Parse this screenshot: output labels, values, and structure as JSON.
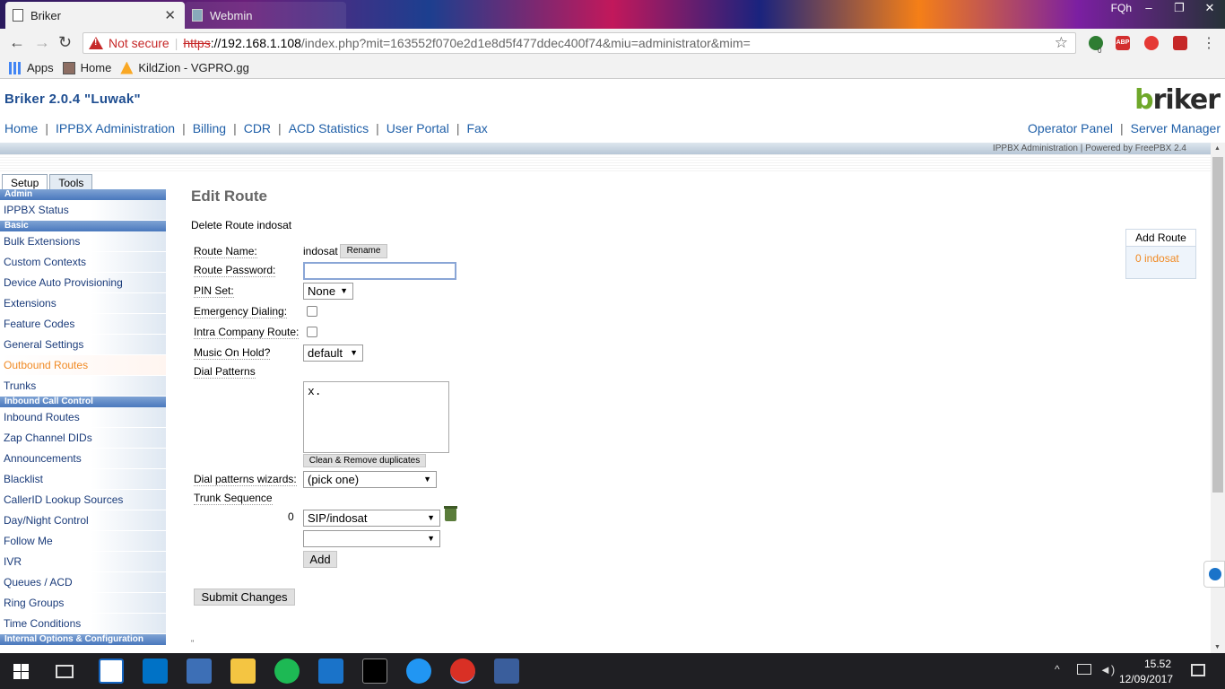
{
  "browser": {
    "tabs": [
      {
        "label": "Briker",
        "active": true
      },
      {
        "label": "Webmin",
        "active": false
      }
    ],
    "window_user": "FQh",
    "window_controls": [
      "–",
      "❐",
      "✕"
    ],
    "security_label": "Not secure",
    "url_scheme": "https",
    "url_host": "://192.168.1.108",
    "url_path": "/index.php?mit=163552f070e2d1e8d5f477ddec400f74&miu=administrator&mim=",
    "bookmarks": [
      "Apps",
      "Home",
      "KildZion - VGPRO.gg"
    ],
    "extension_badge": "0"
  },
  "app": {
    "title": "Briker 2.0.4 \"Luwak\"",
    "logo": {
      "first": "b",
      "rest": "riker"
    },
    "nav_left": [
      "Home",
      "IPPBX Administration",
      "Billing",
      "CDR",
      "ACD Statistics",
      "User Portal",
      "Fax"
    ],
    "nav_right": [
      "Operator Panel",
      "Server Manager"
    ],
    "powered_by": "IPPBX Administration | Powered by FreePBX 2.4"
  },
  "sidebar": {
    "tabs": [
      "Setup",
      "Tools"
    ],
    "sections": [
      {
        "heading": "Admin",
        "items": [
          "IPPBX Status"
        ]
      },
      {
        "heading": "Basic",
        "items": [
          "Bulk Extensions",
          "Custom Contexts",
          "Device Auto Provisioning",
          "Extensions",
          "Feature Codes",
          "General Settings",
          "Outbound Routes",
          "Trunks"
        ]
      },
      {
        "heading": "Inbound Call Control",
        "items": [
          "Inbound Routes",
          "Zap Channel DIDs",
          "Announcements",
          "Blacklist",
          "CallerID Lookup Sources",
          "Day/Night Control",
          "Follow Me",
          "IVR",
          "Queues / ACD",
          "Ring Groups",
          "Time Conditions"
        ]
      },
      {
        "heading": "Internal Options & Configuration",
        "items": []
      }
    ],
    "current_item": "Outbound Routes"
  },
  "form": {
    "heading": "Edit Route",
    "delete_link": "Delete Route indosat",
    "route_name_label": "Route Name:",
    "route_name_value": "indosat",
    "rename_button": "Rename",
    "route_password_label": "Route Password:",
    "route_password_value": "",
    "pin_set_label": "PIN Set:",
    "pin_set_value": "None",
    "emergency_label": "Emergency Dialing:",
    "emergency_checked": false,
    "intra_label": "Intra Company Route:",
    "intra_checked": false,
    "moh_label": "Music On Hold?",
    "moh_value": "default",
    "dial_patterns_label": "Dial Patterns",
    "dial_patterns_value": "x.",
    "clean_button": "Clean & Remove duplicates",
    "wizard_label": "Dial patterns wizards:",
    "wizard_value": "(pick one)",
    "trunk_sequence_label": "Trunk Sequence",
    "trunk_index": "0",
    "trunk_value": "SIP/indosat",
    "trunk_empty_value": "",
    "add_button": "Add",
    "submit_button": "Submit Changes",
    "footer_mark": "\""
  },
  "routes_panel": {
    "add_route": "Add Route",
    "routes": [
      "0 indosat"
    ]
  },
  "taskbar": {
    "time": "15.52",
    "date": "12/09/2017"
  },
  "colors": {
    "nav_link": "#1f5fa8",
    "current_item": "#f08a24",
    "sidebar_heading": "#4a78bd",
    "insecure": "#c62828"
  }
}
